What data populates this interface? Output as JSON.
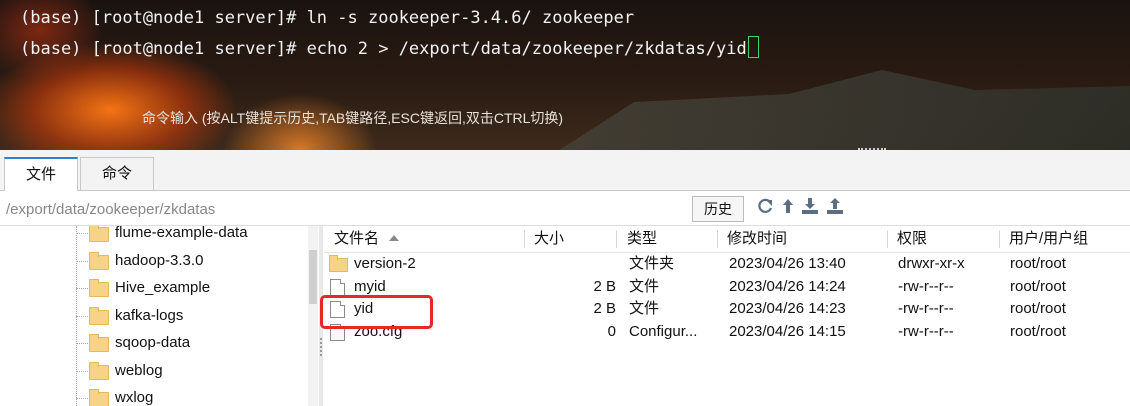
{
  "terminal": {
    "lines": [
      "(base) [root@node1 server]# ln -s zookeeper-3.4.6/ zookeeper",
      "(base) [root@node1 server]# echo 2 > /export/data/zookeeper/zkdatas/yid"
    ],
    "hint": "命令输入 (按ALT键提示历史,TAB键路径,ESC键返回,双击CTRL切换)"
  },
  "tabs": [
    {
      "label": "文件",
      "active": true
    },
    {
      "label": "命令",
      "active": false
    }
  ],
  "pathbar": {
    "path": "/export/data/zookeeper/zkdatas",
    "history_label": "历史",
    "icons": [
      "refresh-icon",
      "up-arrow-icon",
      "download-icon",
      "upload-icon"
    ]
  },
  "tree": {
    "items": [
      "flume-example-data",
      "hadoop-3.3.0",
      "Hive_example",
      "kafka-logs",
      "sqoop-data",
      "weblog",
      "wxlog"
    ]
  },
  "files": {
    "columns": [
      "文件名",
      "大小",
      "类型",
      "修改时间",
      "权限",
      "用户/用户组"
    ],
    "rows": [
      {
        "name": "version-2",
        "size": "",
        "type": "文件夹",
        "mtime": "2023/04/26 13:40",
        "perm": "drwxr-xr-x",
        "owner": "root/root",
        "icon": "folder-icon"
      },
      {
        "name": "myid",
        "size": "2 B",
        "type": "文件",
        "mtime": "2023/04/26 14:24",
        "perm": "-rw-r--r--",
        "owner": "root/root",
        "icon": "file-icon"
      },
      {
        "name": "yid",
        "size": "2 B",
        "type": "文件",
        "mtime": "2023/04/26 14:23",
        "perm": "-rw-r--r--",
        "owner": "root/root",
        "icon": "file-icon"
      },
      {
        "name": "zoo.cfg",
        "size": "0",
        "type": "Configur...",
        "mtime": "2023/04/26 14:15",
        "perm": "-rw-r--r--",
        "owner": "root/root",
        "icon": "config-file-icon"
      }
    ]
  },
  "colors": {
    "highlight": "#e52828",
    "tab_accent": "#2d7fd3",
    "cursor": "#39d36a"
  }
}
